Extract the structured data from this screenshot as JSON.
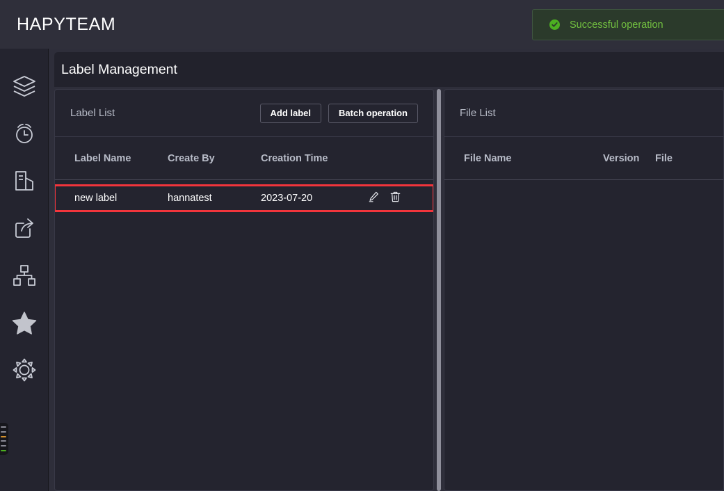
{
  "app": {
    "brand": "HAPYTEAM"
  },
  "toast": {
    "icon": "check-circle-icon",
    "message": "Successful operation",
    "accent_color": "#72c040",
    "bg_color": "#2b3a2b"
  },
  "sidebar": {
    "items": [
      {
        "icon": "layers-icon",
        "name": "sidebar-item-layers"
      },
      {
        "icon": "alarm-clock-icon",
        "name": "sidebar-item-alarm"
      },
      {
        "icon": "building-icon",
        "name": "sidebar-item-building"
      },
      {
        "icon": "share-icon",
        "name": "sidebar-item-share"
      },
      {
        "icon": "sitemap-icon",
        "name": "sidebar-item-sitemap"
      },
      {
        "icon": "star-icon",
        "name": "sidebar-item-favorites"
      },
      {
        "icon": "gear-icon",
        "name": "sidebar-item-settings"
      }
    ]
  },
  "page": {
    "title": "Label Management"
  },
  "label_panel": {
    "title": "Label List",
    "buttons": {
      "add": "Add label",
      "batch": "Batch operation"
    },
    "columns": [
      "Label Name",
      "Create By",
      "Creation Time"
    ],
    "rows": [
      {
        "label_name": "new label",
        "create_by": "hannatest",
        "creation_time": "2023-07-20",
        "actions": [
          "edit-icon",
          "delete-icon"
        ],
        "highlighted": true,
        "highlight_color": "#f2353c"
      }
    ]
  },
  "file_panel": {
    "title": "File List",
    "columns": [
      "File Name",
      "Version",
      "File "
    ],
    "rows": []
  }
}
